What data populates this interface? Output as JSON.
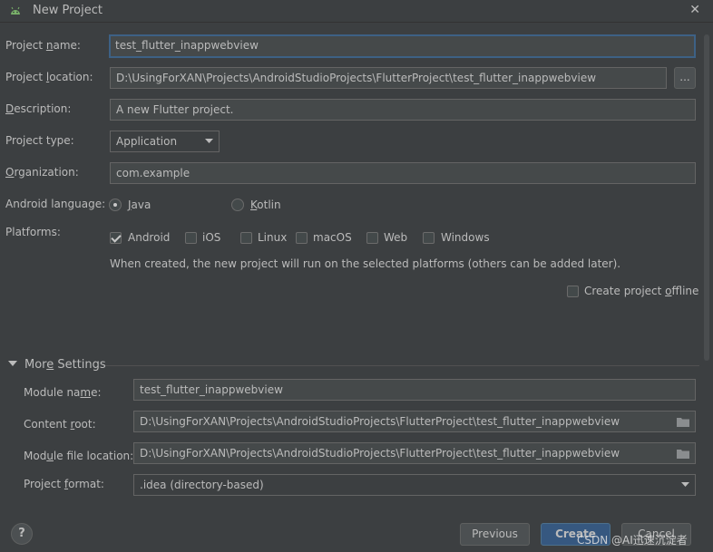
{
  "window": {
    "title": "New Project",
    "close_glyph": "✕"
  },
  "form": {
    "project_name": {
      "label_pre": "Project ",
      "label_u": "n",
      "label_post": "ame:",
      "value": "test_flutter_inappwebview"
    },
    "project_location": {
      "label_pre": "Project ",
      "label_u": "l",
      "label_post": "ocation:",
      "value": "D:\\UsingForXAN\\Projects\\AndroidStudioProjects\\FlutterProject\\test_flutter_inappwebview",
      "browse": "..."
    },
    "description": {
      "label_pre": "",
      "label_u": "D",
      "label_post": "escription:",
      "value": "A new Flutter project."
    },
    "project_type": {
      "label": "Project type:",
      "value": "Application"
    },
    "organization": {
      "label_pre": "",
      "label_u": "O",
      "label_post": "rganization:",
      "value": "com.example"
    },
    "android_language": {
      "label": "Android language:",
      "java": {
        "pre": "",
        "u": "J",
        "post": "ava"
      },
      "kotlin": {
        "pre": "",
        "u": "K",
        "post": "otlin"
      },
      "selected": "Java"
    },
    "platforms": {
      "label": "Platforms:",
      "items": [
        {
          "label": "Android",
          "checked": true
        },
        {
          "label": "iOS",
          "checked": false
        },
        {
          "label": "Linux",
          "checked": false
        },
        {
          "label": "macOS",
          "checked": false
        },
        {
          "label": "Web",
          "checked": false
        },
        {
          "label": "Windows",
          "checked": false
        }
      ],
      "hint": "When created, the new project will run on the selected platforms (others can be added later)."
    },
    "offline": {
      "pre": "Create project ",
      "u": "o",
      "post": "ffline",
      "checked": false
    }
  },
  "more_settings": {
    "title_pre": "Mor",
    "title_u": "e",
    "title_post": " Settings",
    "module_name": {
      "label_pre": "Module na",
      "label_u": "m",
      "label_post": "e:",
      "value": "test_flutter_inappwebview"
    },
    "content_root": {
      "label_pre": "Content ",
      "label_u": "r",
      "label_post": "oot:",
      "value": "D:\\UsingForXAN\\Projects\\AndroidStudioProjects\\FlutterProject\\test_flutter_inappwebview"
    },
    "module_file_location": {
      "label_pre": "Mod",
      "label_u": "u",
      "label_post": "le file location:",
      "value": "D:\\UsingForXAN\\Projects\\AndroidStudioProjects\\FlutterProject\\test_flutter_inappwebview"
    },
    "project_format": {
      "label_pre": "Project ",
      "label_u": "f",
      "label_post": "ormat:",
      "value": ".idea (directory-based)"
    }
  },
  "footer": {
    "help": "?",
    "previous": "Previous",
    "create": "Create",
    "cancel": "Cancel",
    "watermark": "CSDN @AI迅速沉淀者"
  },
  "colors": {
    "background": "#3c3f41",
    "field": "#45494a",
    "accent": "#365880",
    "focus": "#3d6185"
  }
}
